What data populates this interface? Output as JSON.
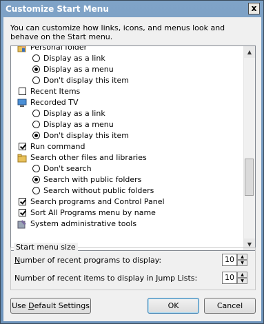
{
  "window": {
    "title": "Customize Start Menu",
    "close_glyph": "x"
  },
  "description": "You can customize how links, icons, and menus look and behave on the Start menu.",
  "list": {
    "items": [
      {
        "type": "header",
        "icon": "personal-folder-icon",
        "label": "Personal folder"
      },
      {
        "type": "radio",
        "checked": false,
        "label": "Display as a link"
      },
      {
        "type": "radio",
        "checked": true,
        "label": "Display as a menu"
      },
      {
        "type": "radio",
        "checked": false,
        "label": "Don't display this item"
      },
      {
        "type": "checkbox",
        "checked": false,
        "label": "Recent Items"
      },
      {
        "type": "header",
        "icon": "recorded-tv-icon",
        "label": "Recorded TV"
      },
      {
        "type": "radio",
        "checked": false,
        "label": "Display as a link"
      },
      {
        "type": "radio",
        "checked": false,
        "label": "Display as a menu"
      },
      {
        "type": "radio",
        "checked": true,
        "label": "Don't display this item"
      },
      {
        "type": "checkbox",
        "checked": true,
        "label": "Run command"
      },
      {
        "type": "header",
        "icon": "search-folder-icon",
        "label": "Search other files and libraries"
      },
      {
        "type": "radio",
        "checked": false,
        "label": "Don't search"
      },
      {
        "type": "radio",
        "checked": true,
        "label": "Search with public folders"
      },
      {
        "type": "radio",
        "checked": false,
        "label": "Search without public folders"
      },
      {
        "type": "checkbox",
        "checked": true,
        "label": "Search programs and Control Panel"
      },
      {
        "type": "checkbox",
        "checked": true,
        "label": "Sort All Programs menu by name"
      },
      {
        "type": "header",
        "icon": "admin-tools-icon",
        "label": "System administrative tools"
      }
    ],
    "scroll_up_glyph": "▲",
    "scroll_down_glyph": "▼"
  },
  "start_menu_size": {
    "group_label": "Start menu size",
    "recent_programs_label_prefix": "N",
    "recent_programs_label_rest": "umber of recent programs to display:",
    "recent_programs_value": "10",
    "recent_items_label_prefix": "Number of recent items to display in ",
    "recent_items_label_mnemonic": "J",
    "recent_items_label_rest": "ump Lists:",
    "recent_items_value": "10",
    "spin_up_glyph": "▲",
    "spin_down_glyph": "▼"
  },
  "buttons": {
    "defaults_prefix": "Use ",
    "defaults_mnemonic": "D",
    "defaults_rest": "efault Settings",
    "ok": "OK",
    "cancel": "Cancel"
  },
  "colors": {
    "title_bar": "#7fa3c7",
    "dialog_bg": "#f0f0f0",
    "default_button_border": "#3c7fb1"
  }
}
